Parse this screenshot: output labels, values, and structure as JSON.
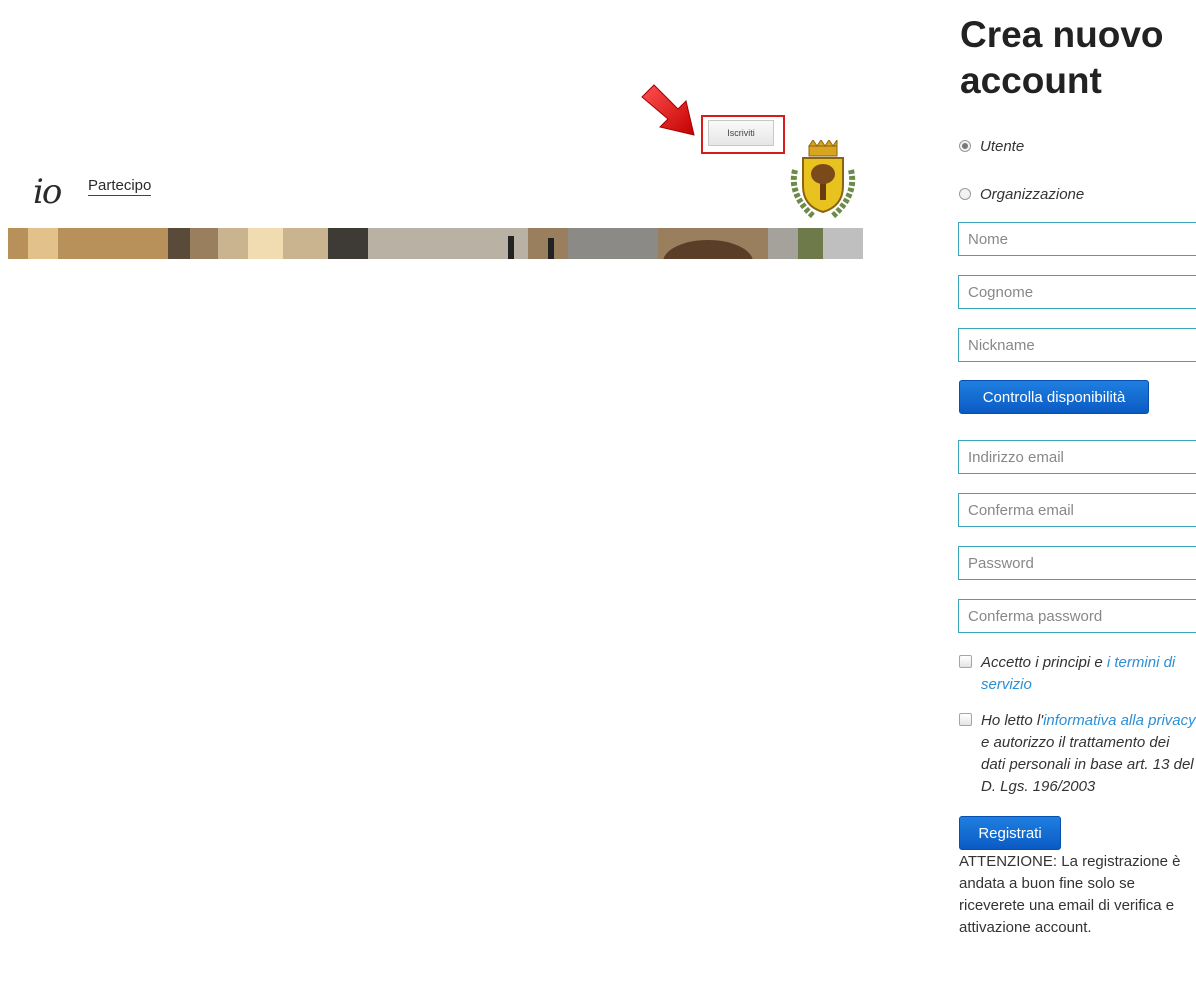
{
  "header": {
    "signup_button_label": "Iscriviti",
    "logo_prefix": "io",
    "logo_text": "Partecipo",
    "arrow_color": "#e02020",
    "highlight_color": "#d81b1b"
  },
  "form": {
    "title": "Crea nuovo account",
    "account_types": [
      {
        "label": "Utente",
        "checked": true
      },
      {
        "label": "Organizzazione",
        "checked": false
      }
    ],
    "fields": {
      "nome": {
        "placeholder": "Nome"
      },
      "cognome": {
        "placeholder": "Cognome"
      },
      "nickname": {
        "placeholder": "Nickname"
      },
      "email": {
        "placeholder": "Indirizzo email"
      },
      "email_confirm": {
        "placeholder": "Conferma email"
      },
      "password": {
        "placeholder": "Password"
      },
      "password_confirm": {
        "placeholder": "Conferma password"
      }
    },
    "check_availability_label": "Controlla disponibilità",
    "terms": {
      "prefix": "Accetto i principi e ",
      "link": "i termini di servizio"
    },
    "privacy": {
      "prefix": "Ho letto l'",
      "link": "informativa alla privacy",
      "suffix": " e autorizzo il trattamento dei dati personali in base art. 13 del D. Lgs. 196/2003"
    },
    "register_label": "Registrati",
    "notice": "ATTENZIONE: La registrazione è andata a buon fine solo se riceverete una email di verifica e attivazione account.",
    "accent_color": "#1f7fe0",
    "input_border_color": "#3aa6b9",
    "link_color": "#2c8fd6"
  }
}
